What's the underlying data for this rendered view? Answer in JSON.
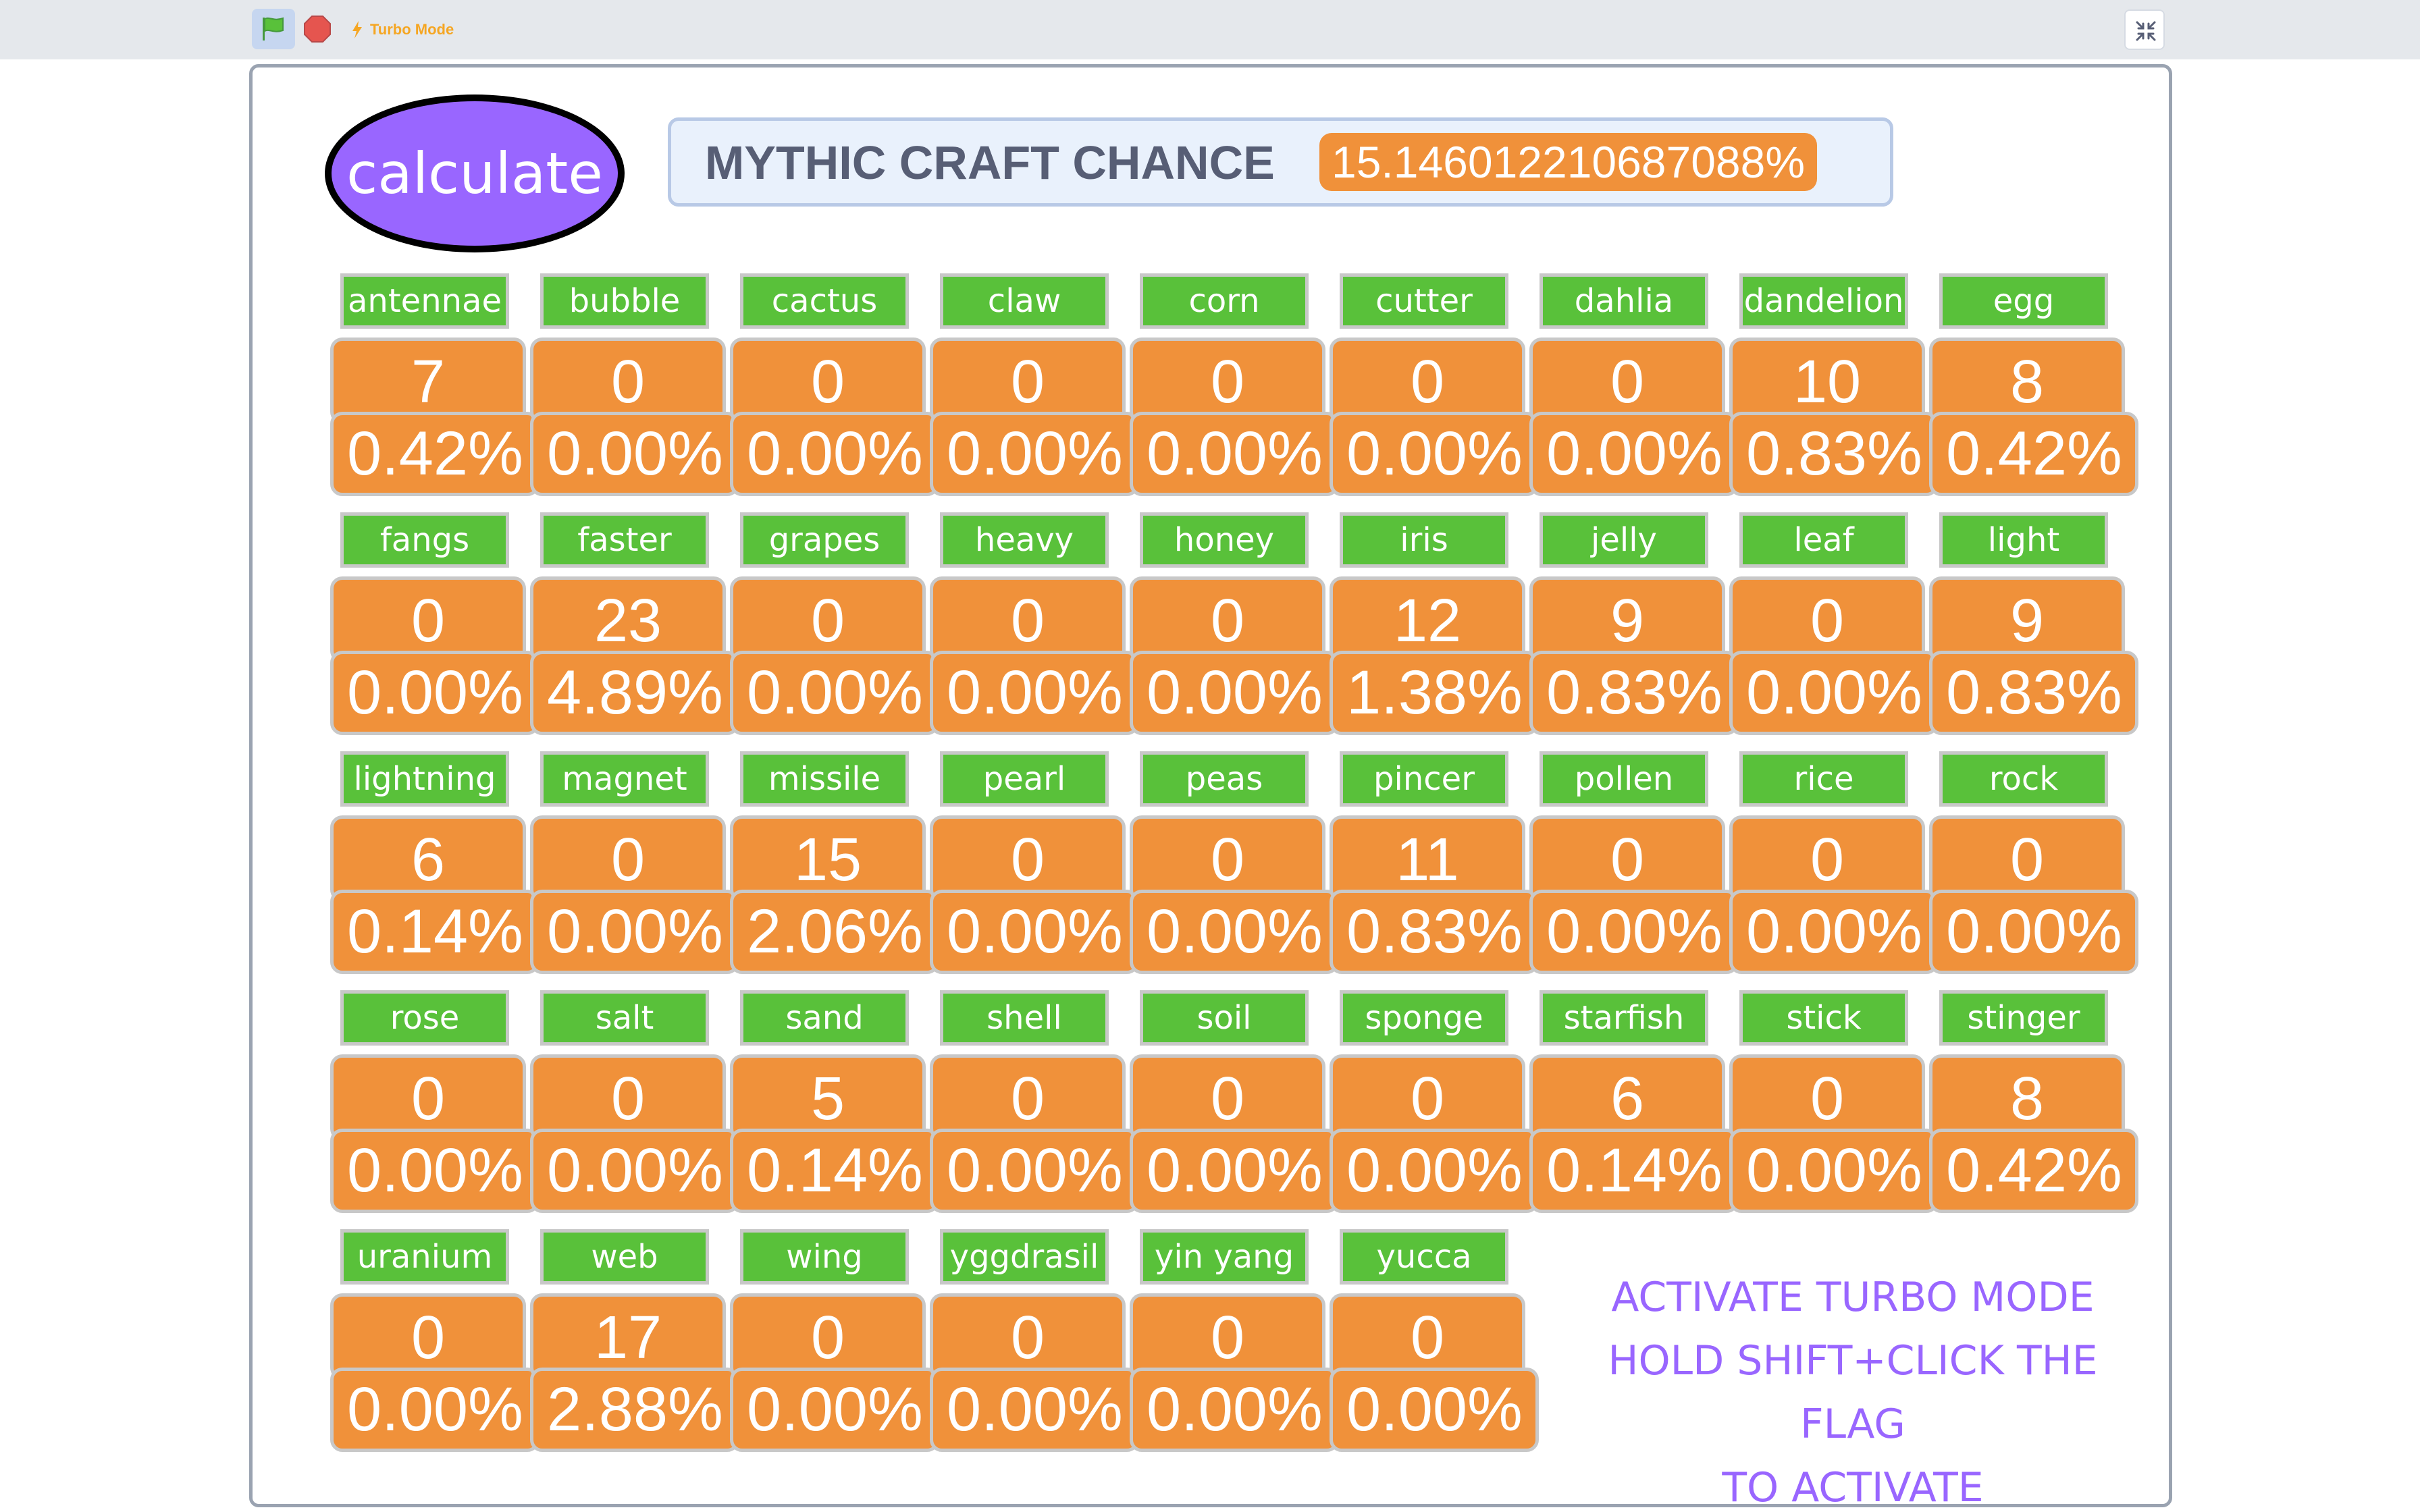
{
  "toolbar": {
    "turbo_label": "Turbo Mode",
    "colors": {
      "flag": "#59c13a",
      "stop": "#e5554f",
      "turbo": "#f5a623"
    }
  },
  "stage": {
    "calculate_label": "calculate",
    "chance_label": "MYTHIC CRAFT CHANCE",
    "chance_value": "15.146012210687088%",
    "note_lines": [
      "ACTIVATE TURBO MODE",
      "HOLD SHIFT+CLICK THE FLAG",
      "TO ACTIVATE"
    ],
    "colors": {
      "name_bg": "#59c13a",
      "value_bg": "#f0913a",
      "calculate_bg": "#9966ff",
      "note_text": "#9966ff"
    }
  },
  "cells": [
    {
      "name": "antennae",
      "count": "7",
      "pct": "0.42%"
    },
    {
      "name": "bubble",
      "count": "0",
      "pct": "0.00%"
    },
    {
      "name": "cactus",
      "count": "0",
      "pct": "0.00%"
    },
    {
      "name": "claw",
      "count": "0",
      "pct": "0.00%"
    },
    {
      "name": "corn",
      "count": "0",
      "pct": "0.00%"
    },
    {
      "name": "cutter",
      "count": "0",
      "pct": "0.00%"
    },
    {
      "name": "dahlia",
      "count": "0",
      "pct": "0.00%"
    },
    {
      "name": "dandelion",
      "count": "10",
      "pct": "0.83%"
    },
    {
      "name": "egg",
      "count": "8",
      "pct": "0.42%"
    },
    {
      "name": "fangs",
      "count": "0",
      "pct": "0.00%"
    },
    {
      "name": "faster",
      "count": "23",
      "pct": "4.89%"
    },
    {
      "name": "grapes",
      "count": "0",
      "pct": "0.00%"
    },
    {
      "name": "heavy",
      "count": "0",
      "pct": "0.00%"
    },
    {
      "name": "honey",
      "count": "0",
      "pct": "0.00%"
    },
    {
      "name": "iris",
      "count": "12",
      "pct": "1.38%"
    },
    {
      "name": "jelly",
      "count": "9",
      "pct": "0.83%"
    },
    {
      "name": "leaf",
      "count": "0",
      "pct": "0.00%"
    },
    {
      "name": "light",
      "count": "9",
      "pct": "0.83%"
    },
    {
      "name": "lightning",
      "count": "6",
      "pct": "0.14%"
    },
    {
      "name": "magnet",
      "count": "0",
      "pct": "0.00%"
    },
    {
      "name": "missile",
      "count": "15",
      "pct": "2.06%"
    },
    {
      "name": "pearl",
      "count": "0",
      "pct": "0.00%"
    },
    {
      "name": "peas",
      "count": "0",
      "pct": "0.00%"
    },
    {
      "name": "pincer",
      "count": "11",
      "pct": "0.83%"
    },
    {
      "name": "pollen",
      "count": "0",
      "pct": "0.00%"
    },
    {
      "name": "rice",
      "count": "0",
      "pct": "0.00%"
    },
    {
      "name": "rock",
      "count": "0",
      "pct": "0.00%"
    },
    {
      "name": "rose",
      "count": "0",
      "pct": "0.00%"
    },
    {
      "name": "salt",
      "count": "0",
      "pct": "0.00%"
    },
    {
      "name": "sand",
      "count": "5",
      "pct": "0.14%"
    },
    {
      "name": "shell",
      "count": "0",
      "pct": "0.00%"
    },
    {
      "name": "soil",
      "count": "0",
      "pct": "0.00%"
    },
    {
      "name": "sponge",
      "count": "0",
      "pct": "0.00%"
    },
    {
      "name": "starfish",
      "count": "6",
      "pct": "0.14%"
    },
    {
      "name": "stick",
      "count": "0",
      "pct": "0.00%"
    },
    {
      "name": "stinger",
      "count": "8",
      "pct": "0.42%"
    },
    {
      "name": "uranium",
      "count": "0",
      "pct": "0.00%"
    },
    {
      "name": "web",
      "count": "17",
      "pct": "2.88%"
    },
    {
      "name": "wing",
      "count": "0",
      "pct": "0.00%"
    },
    {
      "name": "yggdrasil",
      "count": "0",
      "pct": "0.00%"
    },
    {
      "name": "yin yang",
      "count": "0",
      "pct": "0.00%"
    },
    {
      "name": "yucca",
      "count": "0",
      "pct": "0.00%"
    }
  ]
}
